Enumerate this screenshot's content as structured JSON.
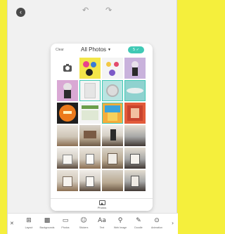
{
  "topbar": {
    "back_icon": "chevron-left-icon",
    "back_glyph": "‹",
    "undo_glyph": "↶",
    "redo_glyph": "↷"
  },
  "panel": {
    "clear_label": "Clear",
    "title": "All Photos",
    "title_caret": "▼",
    "confirm_glyph": "5 ✓",
    "footer_tab_label": "Photos"
  },
  "toolbar": {
    "close_glyph": "✕",
    "more_glyph": "›",
    "items": [
      {
        "label": "Layout",
        "glyph": "⊞",
        "icon": "layout-icon"
      },
      {
        "label": "Backgrounds",
        "glyph": "▩",
        "icon": "backgrounds-icon"
      },
      {
        "label": "Photos",
        "glyph": "▭",
        "icon": "photos-icon"
      },
      {
        "label": "Stickers",
        "glyph": "☺",
        "icon": "stickers-icon"
      },
      {
        "label": "Text",
        "glyph": "Aa",
        "icon": "text-icon"
      },
      {
        "label": "Web Image",
        "glyph": "⚲",
        "icon": "web-image-icon"
      },
      {
        "label": "Doodle",
        "glyph": "✎",
        "icon": "doodle-icon"
      },
      {
        "label": "Animation",
        "glyph": "⊙",
        "icon": "animation-icon"
      }
    ]
  },
  "colors": {
    "background": "#f5ef3c",
    "accent": "#40c9b5",
    "frame": "#f1f1f1"
  }
}
